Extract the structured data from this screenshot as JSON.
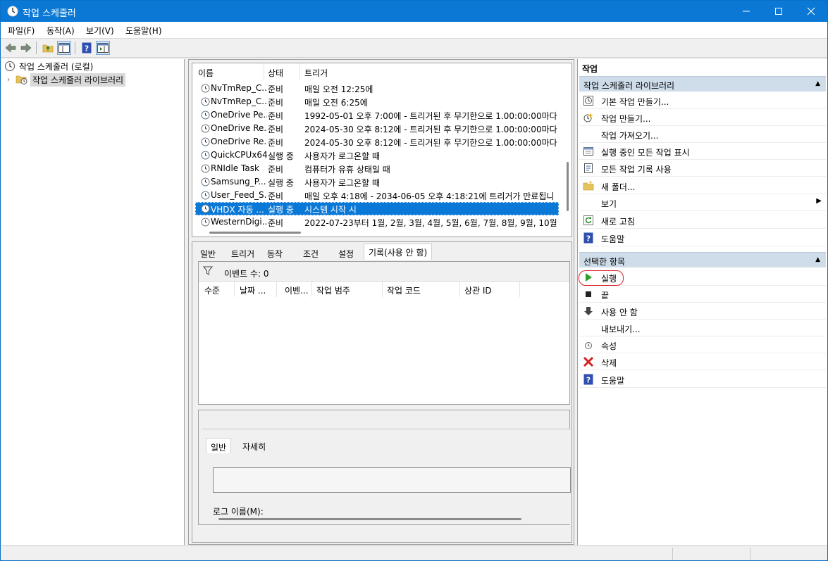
{
  "window": {
    "title": "작업 스케줄러"
  },
  "menu": [
    {
      "label": "파일(F)"
    },
    {
      "label": "동작(A)"
    },
    {
      "label": "보기(V)"
    },
    {
      "label": "도움말(H)"
    }
  ],
  "tree": {
    "root": "작업 스케줄러 (로컬)",
    "child": "작업 스케줄러 라이브러리"
  },
  "task_list": {
    "columns": [
      "이름",
      "상태",
      "트리거"
    ],
    "rows": [
      {
        "name": "NvTmRep_C...",
        "status": "준비",
        "trigger": "매일 오전 12:25에"
      },
      {
        "name": "NvTmRep_C...",
        "status": "준비",
        "trigger": "매일 오전 6:25에"
      },
      {
        "name": "OneDrive Pe...",
        "status": "준비",
        "trigger": "1992-05-01 오후 7:00에 - 트리거된 후 무기한으로 1.00:00:00마다"
      },
      {
        "name": "OneDrive Re...",
        "status": "준비",
        "trigger": "2024-05-30 오후 8:12에 - 트리거된 후 무기한으로 1.00:00:00마다"
      },
      {
        "name": "OneDrive Re...",
        "status": "준비",
        "trigger": "2024-05-30 오후 8:12에 - 트리거된 후 무기한으로 1.00:00:00마다"
      },
      {
        "name": "QuickCPUx64",
        "status": "실행 중",
        "trigger": "사용자가 로그온할 때"
      },
      {
        "name": "RNIdle Task",
        "status": "준비",
        "trigger": "컴퓨터가 유휴 상태일 때"
      },
      {
        "name": "Samsung_P...",
        "status": "실행 중",
        "trigger": "사용자가 로그온할 때"
      },
      {
        "name": "User_Feed_S...",
        "status": "준비",
        "trigger": "매일 오후 4:18에 - 2034-06-05 오후 4:18:21에 트리거가 만료됩니"
      },
      {
        "name": "VHDX 자동 ...",
        "status": "실행 중",
        "trigger": "시스템 시작 시"
      },
      {
        "name": "WesternDigi...",
        "status": "준비",
        "trigger": "2022-07-23부터 1월, 2월, 3월, 4월, 5월, 6월, 7월, 8월, 9월, 10월"
      }
    ],
    "selected_index": 9
  },
  "detail_tabs": [
    {
      "label": "일반"
    },
    {
      "label": "트리거"
    },
    {
      "label": "동작"
    },
    {
      "label": "조건"
    },
    {
      "label": "설정"
    },
    {
      "label": "기록(사용 안 함)"
    }
  ],
  "history": {
    "event_count": "이벤트 수: 0",
    "columns": [
      "수준",
      "날짜 ...",
      "이벤...",
      "작업 범주",
      "작업 코드",
      "상관 ID"
    ]
  },
  "log": {
    "tabs": [
      {
        "label": "일반"
      },
      {
        "label": "자세히"
      }
    ],
    "log_name_label": "로그 이름(M):"
  },
  "actions": {
    "title": "작업",
    "library_section": "작업 스케줄러 라이브러리",
    "library_items": [
      {
        "label": "기본 작업 만들기...",
        "icon": "basic-task-icon"
      },
      {
        "label": "작업 만들기...",
        "icon": "create-task-icon"
      },
      {
        "label": "작업 가져오기...",
        "icon": ""
      },
      {
        "label": "실행 중인 모든 작업 표시",
        "icon": "running-tasks-icon"
      },
      {
        "label": "모든 작업 기록 사용",
        "icon": "history-icon"
      },
      {
        "label": "새 폴더...",
        "icon": "folder-icon"
      },
      {
        "label": "보기",
        "icon": ""
      },
      {
        "label": "새로 고침",
        "icon": "refresh-icon"
      },
      {
        "label": "도움말",
        "icon": "help-icon"
      }
    ],
    "selected_section": "선택한 항목",
    "selected_items": [
      {
        "label": "실행",
        "icon": "run-icon"
      },
      {
        "label": "끝",
        "icon": "stop-icon"
      },
      {
        "label": "사용 안 함",
        "icon": "disable-icon"
      },
      {
        "label": "내보내기...",
        "icon": ""
      },
      {
        "label": "속성",
        "icon": "properties-icon"
      },
      {
        "label": "삭제",
        "icon": "delete-icon"
      },
      {
        "label": "도움말",
        "icon": "help-icon"
      }
    ]
  },
  "colors": {
    "titlebar": "#0a78d4",
    "selection": "#0a78d7",
    "section_header": "#cfdcea",
    "highlight": "#e0202a"
  }
}
